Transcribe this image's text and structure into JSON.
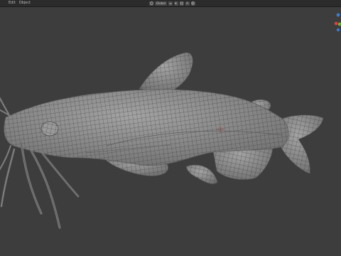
{
  "menu": {
    "items": [
      {
        "label": "Edit"
      },
      {
        "label": "Object"
      }
    ]
  },
  "header": {
    "orientation": {
      "value": "Global"
    }
  },
  "colors": {
    "mesh": "#8a8a8a",
    "wire": "#2e2e2e",
    "background": "#3d3d3d",
    "gizmo_x": "#e03c3c",
    "gizmo_y": "#5fb335",
    "gizmo_z": "#3b7bd6"
  },
  "icons": {
    "orientation": "transform-orientation-icon",
    "pivot": "pivot-point-icon",
    "snap": "snap-icon",
    "proportional": "proportional-editing-icon"
  }
}
